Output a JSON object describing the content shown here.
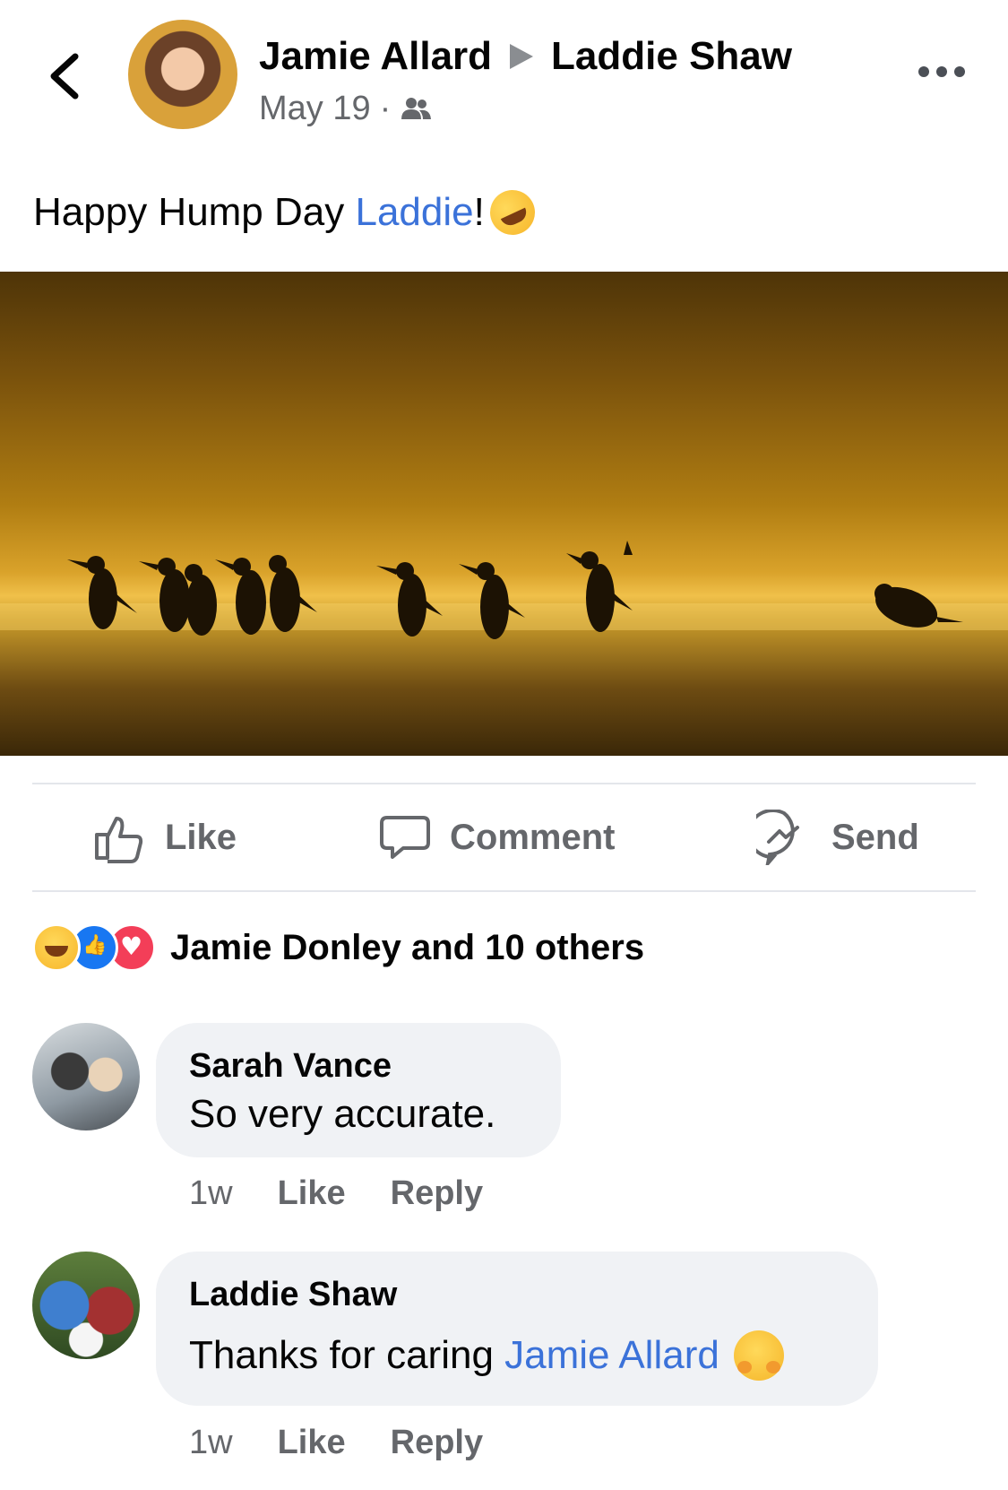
{
  "header": {
    "author": "Jamie Allard",
    "recipient": "Laddie Shaw",
    "date": "May 19",
    "separator": "·",
    "audience_icon": "friends-icon",
    "back_icon": "chevron-left-icon",
    "more_icon": "more-horizontal-icon"
  },
  "post": {
    "text_prefix": "Happy Hump Day ",
    "mention": "Laddie",
    "text_suffix": "!",
    "emoji": "rolling-on-floor-laughing-emoji"
  },
  "actions": {
    "like": "Like",
    "comment": "Comment",
    "send": "Send"
  },
  "reactions": {
    "icons": [
      "haha-reaction",
      "like-reaction",
      "love-reaction"
    ],
    "summary": "Jamie Donley and 10 others"
  },
  "comments": [
    {
      "author": "Sarah Vance",
      "text": "So very accurate.",
      "time": "1w",
      "like": "Like",
      "reply": "Reply"
    },
    {
      "author": "Laddie Shaw",
      "text_prefix": "Thanks for caring ",
      "mention": "Jamie Allard",
      "emoji": "hugging-face-emoji",
      "time": "1w",
      "like": "Like",
      "reply": "Reply"
    }
  ],
  "colors": {
    "link": "#3b72d9",
    "secondary_text": "#65676b",
    "bubble": "#f0f2f5"
  }
}
